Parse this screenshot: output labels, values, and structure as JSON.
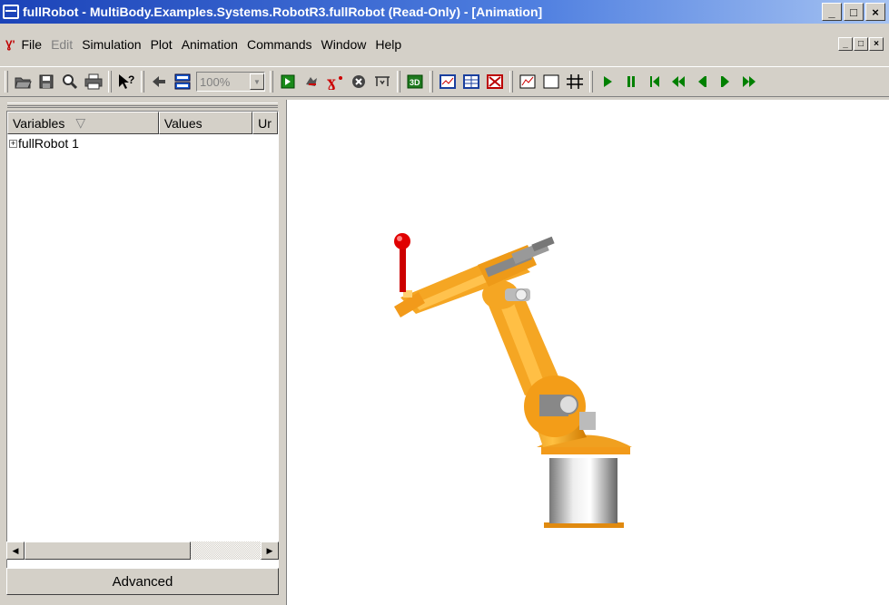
{
  "window": {
    "title": "fullRobot - MultiBody.Examples.Systems.RobotR3.fullRobot  (Read-Only) - [Animation]",
    "min_glyph": "_",
    "max_glyph": "□",
    "close_glyph": "×"
  },
  "menu": {
    "logo": "Ɣ'",
    "items": [
      "File",
      "Edit",
      "Simulation",
      "Plot",
      "Animation",
      "Commands",
      "Window",
      "Help"
    ]
  },
  "toolbar": {
    "zoom_value": "100%",
    "icons": [
      "open-icon",
      "save-icon",
      "search-icon",
      "print-icon",
      "help-pointer-icon",
      "back-icon",
      "split-view-icon",
      "simulation-setup-icon",
      "translate-icon",
      "model-icon",
      "stop-icon",
      "tree-icon",
      "3d-icon",
      "plot-window-icon",
      "table-icon",
      "close-window-icon",
      "new-plot-icon",
      "rectangle-icon",
      "grid-icon"
    ],
    "playback": [
      "play-icon",
      "pause-icon",
      "rewind-start-icon",
      "fast-reverse-icon",
      "step-back-icon",
      "step-forward-icon",
      "fast-forward-icon"
    ],
    "playback_color": "#008000"
  },
  "variables": {
    "columns": [
      "Variables",
      "Values",
      "Ur"
    ],
    "rows": [
      {
        "label": "fullRobot 1"
      }
    ],
    "advanced_label": "Advanced"
  },
  "animation": {
    "robot_color": "#f5a623",
    "handle_color": "#e00000"
  }
}
